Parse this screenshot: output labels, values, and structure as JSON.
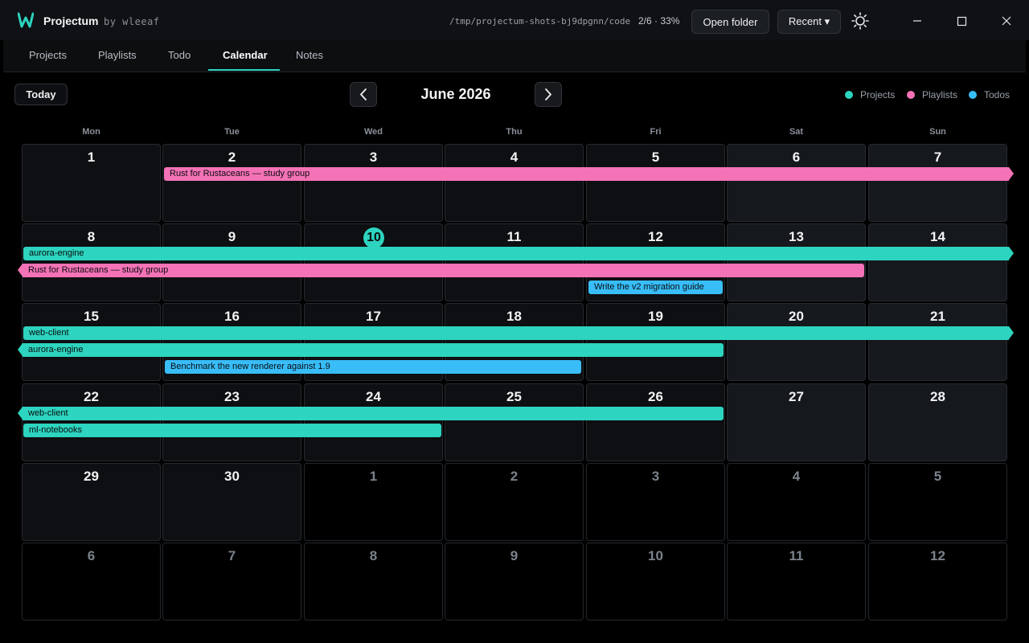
{
  "app": {
    "name": "Projectum",
    "byline": "by wleeaf",
    "path": "/tmp/projectum-shots-bj9dpgnn/code",
    "progress": "2/6 · 33%",
    "open_folder": "Open folder",
    "recent": "Recent ▾"
  },
  "tabs": [
    {
      "label": "Projects",
      "active": false
    },
    {
      "label": "Playlists",
      "active": false
    },
    {
      "label": "Todo",
      "active": false
    },
    {
      "label": "Calendar",
      "active": true
    },
    {
      "label": "Notes",
      "active": false
    }
  ],
  "calendar": {
    "today_label": "Today",
    "month_title": "June 2026",
    "legend": [
      {
        "label": "Projects",
        "color": "#2dd4bf"
      },
      {
        "label": "Playlists",
        "color": "#f472b6"
      },
      {
        "label": "Todos",
        "color": "#38bdf8"
      }
    ],
    "weekdays": [
      "Mon",
      "Tue",
      "Wed",
      "Thu",
      "Fri",
      "Sat",
      "Sun"
    ],
    "weeks": [
      [
        "1",
        "2",
        "3",
        "4",
        "5",
        "6",
        "7"
      ],
      [
        "8",
        "9",
        "10",
        "11",
        "12",
        "13",
        "14"
      ],
      [
        "15",
        "16",
        "17",
        "18",
        "19",
        "20",
        "21"
      ],
      [
        "22",
        "23",
        "24",
        "25",
        "26",
        "27",
        "28"
      ],
      [
        "29",
        "30",
        "1",
        "2",
        "3",
        "4",
        "5"
      ],
      [
        "6",
        "7",
        "8",
        "9",
        "10",
        "11",
        "12"
      ]
    ],
    "today": "10",
    "events": [
      {
        "title": "Rust for Rustaceans — study group",
        "kind": "playlist"
      },
      {
        "title": "aurora-engine",
        "kind": "project"
      },
      {
        "title": "Rust for Rustaceans — study group",
        "kind": "playlist"
      },
      {
        "title": "Write the v2 migration guide",
        "kind": "todo"
      },
      {
        "title": "web-client",
        "kind": "project"
      },
      {
        "title": "aurora-engine",
        "kind": "project"
      },
      {
        "title": "Benchmark the new renderer against 1.9",
        "kind": "todo"
      },
      {
        "title": "web-client",
        "kind": "project"
      },
      {
        "title": "ml-notebooks",
        "kind": "project"
      }
    ]
  }
}
